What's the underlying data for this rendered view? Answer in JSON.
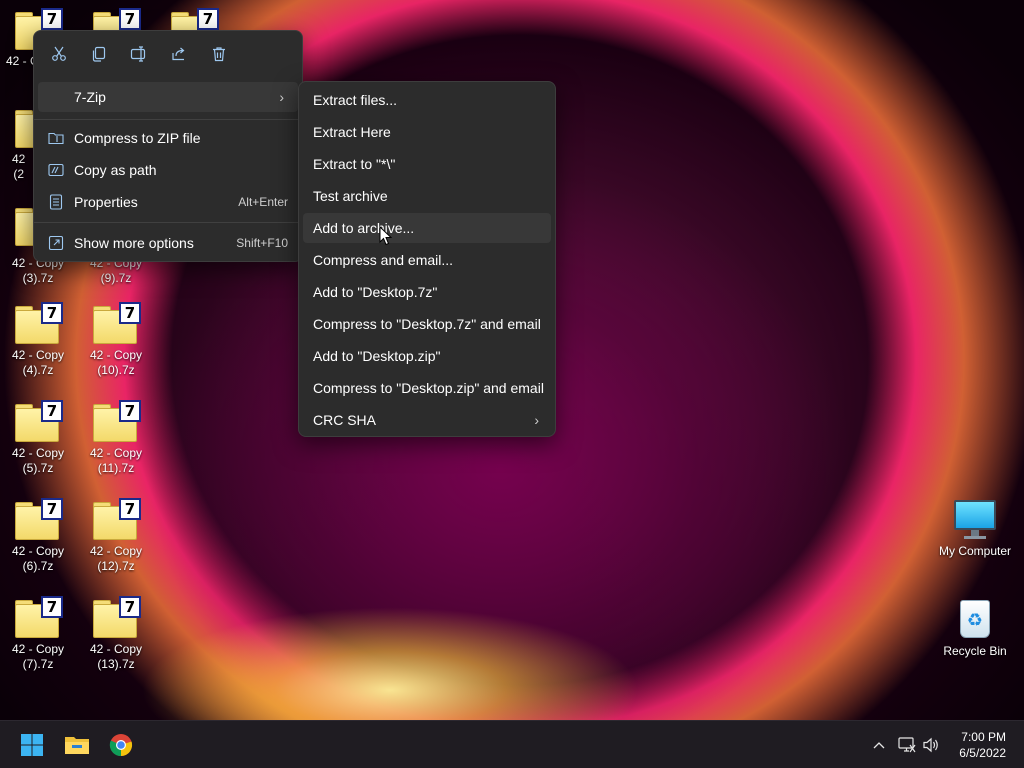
{
  "desktop": {
    "icons_left": [
      {
        "label": "42 - Copy (3).7z"
      },
      {
        "label": "42 - Copy (9).7z"
      },
      {
        "label": "42 - Copy (4).7z"
      },
      {
        "label": "42 - Copy (10).7z"
      },
      {
        "label": "42 - Copy (5).7z"
      },
      {
        "label": "42 - Copy (11).7z"
      },
      {
        "label": "42 - Copy (6).7z"
      },
      {
        "label": "42 - Copy (12).7z"
      },
      {
        "label": "42 - Copy (7).7z"
      },
      {
        "label": "42 - Copy (13).7z"
      }
    ],
    "partial_labels": [
      "42 - C",
      "42",
      "(2"
    ],
    "system_icons": {
      "my_computer": "My Computer",
      "recycle_bin": "Recycle Bin"
    }
  },
  "context_menu": {
    "toolbar": [
      "cut-icon",
      "copy-icon",
      "rename-icon",
      "share-icon",
      "delete-icon"
    ],
    "items": {
      "sevenzip": "7-Zip",
      "compress_zip": "Compress to ZIP file",
      "copy_path": "Copy as path",
      "properties": "Properties",
      "properties_shortcut": "Alt+Enter",
      "more_options": "Show more options",
      "more_options_shortcut": "Shift+F10"
    }
  },
  "submenu": {
    "items": [
      "Extract files...",
      "Extract Here",
      "Extract to \"*\\\"",
      "Test archive",
      "Add to archive...",
      "Compress and email...",
      "Add to \"Desktop.7z\"",
      "Compress to \"Desktop.7z\" and email",
      "Add to \"Desktop.zip\"",
      "Compress to \"Desktop.zip\" and email",
      "CRC SHA"
    ]
  },
  "taskbar": {
    "time": "7:00 PM",
    "date": "6/5/2022"
  },
  "colors": {
    "menu_bg": "#2c2c2c",
    "hover_bg": "#383838",
    "taskbar_bg": "#1f1c22",
    "icon_accent": "#9ec8f0"
  }
}
